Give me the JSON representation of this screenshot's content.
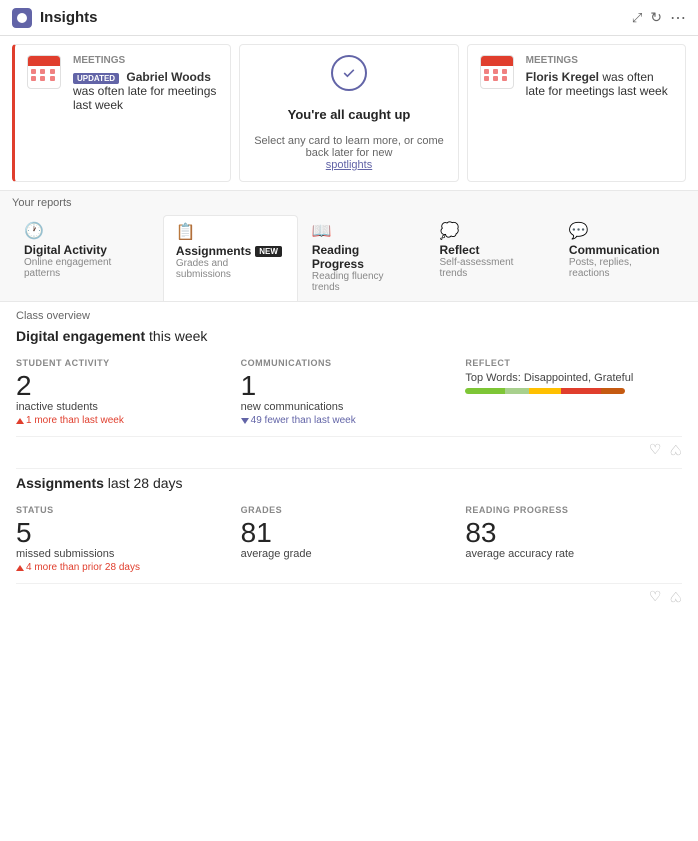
{
  "header": {
    "title": "Insights",
    "icon_label": "insights-icon"
  },
  "spotlights": [
    {
      "id": "card-1",
      "type": "meeting",
      "label": "Meetings",
      "badge": "UPDATED",
      "text": "Gabriel Woods was often late for meetings last week",
      "has_left_border": true
    },
    {
      "id": "card-2",
      "type": "caught-up",
      "title": "You're all caught up",
      "subtitle": "Select any card to learn more, or come back later for new",
      "link": "spotlights"
    },
    {
      "id": "card-3",
      "type": "meeting",
      "label": "Meetings",
      "text": "Floris Kregel was often late for meetings last week",
      "has_left_border": false
    }
  ],
  "reports": {
    "label": "Your reports",
    "tabs": [
      {
        "id": "digital-activity",
        "icon": "🕐",
        "name": "Digital Activity",
        "sub": "Online engagement patterns",
        "active": false,
        "badge": null
      },
      {
        "id": "assignments",
        "icon": "📋",
        "name": "Assignments",
        "sub": "Grades and submissions",
        "active": true,
        "badge": "NEW"
      },
      {
        "id": "reading-progress",
        "icon": "📖",
        "name": "Reading Progress",
        "sub": "Reading fluency trends",
        "active": false,
        "badge": null
      },
      {
        "id": "reflect",
        "icon": "💭",
        "name": "Reflect",
        "sub": "Self-assessment trends",
        "active": false,
        "badge": null
      },
      {
        "id": "communication",
        "icon": "💬",
        "name": "Communication",
        "sub": "Posts, replies, reactions",
        "active": false,
        "badge": null
      }
    ]
  },
  "class_overview": {
    "label": "Class overview",
    "digital_engagement": {
      "title_bold": "Digital engagement",
      "title_rest": " this week",
      "metrics": [
        {
          "category": "STUDENT ACTIVITY",
          "value": "2",
          "desc": "inactive students",
          "change": "▲ 1 more than last week",
          "change_dir": "up"
        },
        {
          "category": "COMMUNICATIONS",
          "value": "1",
          "desc": "new communications",
          "change": "▼ 49 fewer than last week",
          "change_dir": "down"
        },
        {
          "category": "REFLECT",
          "label": "Top Words: Disappointed, Grateful",
          "bar_segments": [
            {
              "color": "#7ec636",
              "pct": 25
            },
            {
              "color": "#a8d08d",
              "pct": 15
            },
            {
              "color": "#ffc000",
              "pct": 20
            },
            {
              "color": "#e03e2d",
              "pct": 25
            },
            {
              "color": "#c55a11",
              "pct": 15
            }
          ]
        }
      ]
    },
    "assignments": {
      "title_bold": "Assignments",
      "title_rest": " last 28 days",
      "metrics": [
        {
          "category": "STATUS",
          "value": "5",
          "desc": "missed submissions",
          "change": "▲ 4 more than prior 28 days",
          "change_dir": "up"
        },
        {
          "category": "GRADES",
          "value": "81",
          "desc": "average grade",
          "change": null
        },
        {
          "category": "READING PROGRESS",
          "value": "83",
          "desc": "average accuracy rate",
          "change": null
        }
      ]
    }
  },
  "icons": {
    "expand": "⤢",
    "refresh": "↻",
    "more": "⋯",
    "thumbup": "♡",
    "thumbdown": "♡"
  }
}
